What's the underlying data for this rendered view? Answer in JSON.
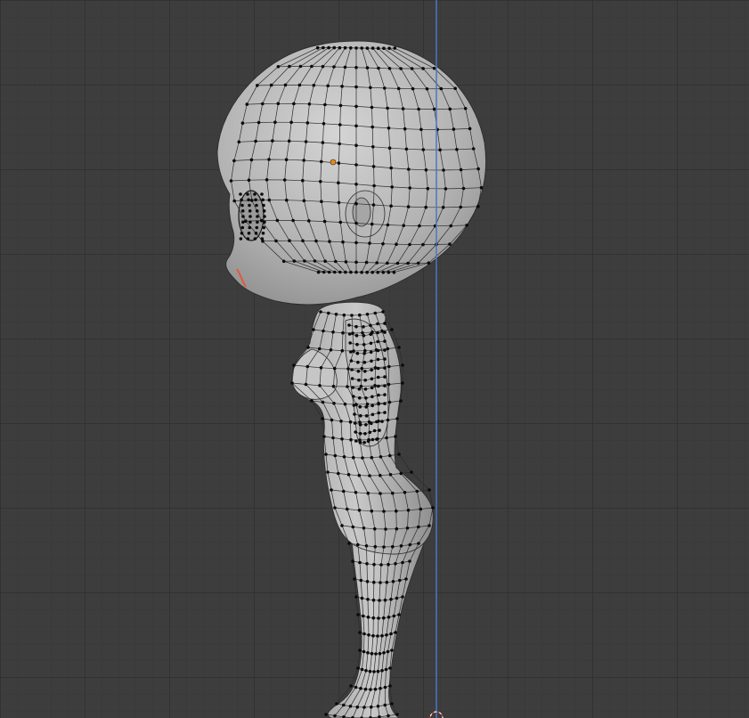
{
  "viewport": {
    "view": "side",
    "mode": "edit",
    "grid_visible": true,
    "colors": {
      "background": "#3d3d3d",
      "grid_minor": "#363636",
      "grid_major": "#2e2e2e",
      "z_axis": "#4a78c2",
      "mesh_fill": "#b6b6b6",
      "wire": "#2c2c2c",
      "vertex": "#0a0a0a",
      "origin": "#e8891c",
      "selected_edge": "#e8553a"
    }
  }
}
